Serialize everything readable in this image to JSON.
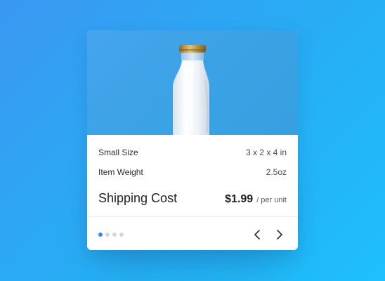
{
  "product": {
    "specs": [
      {
        "label": "Small Size",
        "value": "3 x 2 x 4 in"
      },
      {
        "label": "Item Weight",
        "value": "2.5oz"
      }
    ],
    "shipping": {
      "label": "Shipping Cost",
      "price": "$1.99",
      "unit": "/ per unit"
    }
  },
  "carousel": {
    "total_slides": 4,
    "active_index": 0,
    "prev_icon": "chevron-left-icon",
    "next_icon": "chevron-right-icon"
  },
  "colors": {
    "background_start": "#3a98f2",
    "background_end": "#1ec0fb",
    "hero_background": "#3aa2e4",
    "accent": "#2d8bf0"
  }
}
